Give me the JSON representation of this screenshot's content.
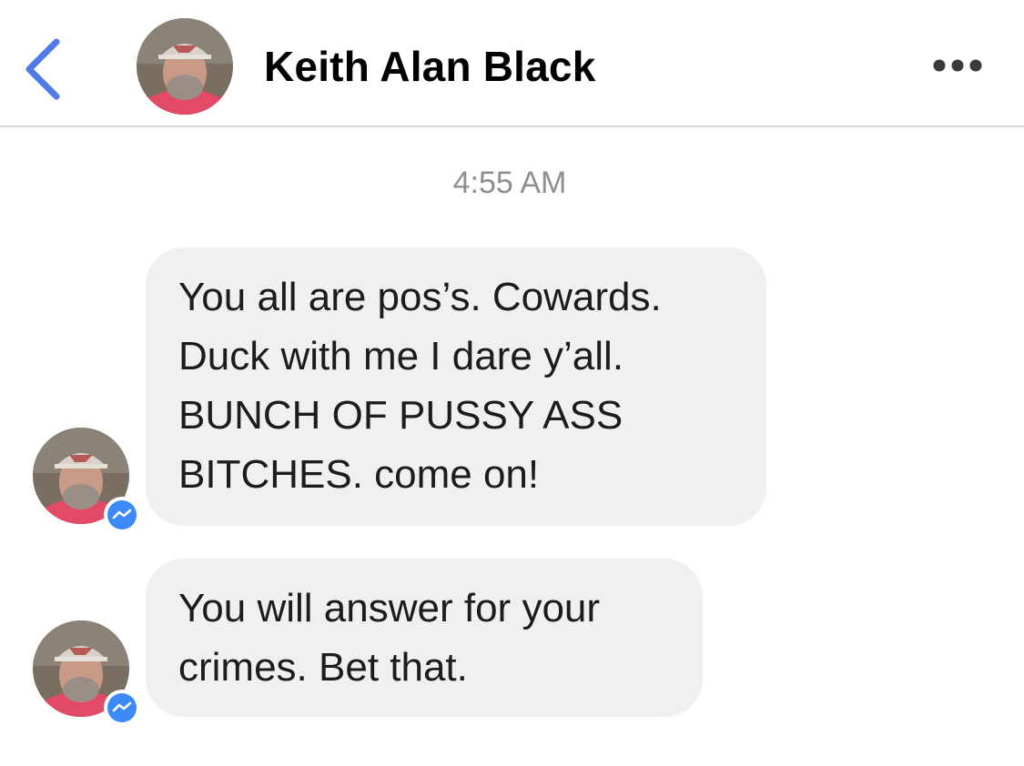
{
  "header": {
    "contact_name": "Keith Alan Black",
    "back_icon": "chevron-left-icon",
    "more_icon": "ellipsis-icon",
    "accent_color": "#4e7be8"
  },
  "conversation": {
    "timestamp": "4:55 AM",
    "messages": [
      {
        "sender": "Keith Alan Black",
        "text": "You all are pos’s. Cowards.\nDuck with me I dare y’all.\nBUNCH OF PUSSY ASS\nBITCHES. come on!"
      },
      {
        "sender": "Keith Alan Black",
        "text": "You will answer for your\ncrimes. Bet that."
      }
    ],
    "badge_icon": "messenger-icon",
    "badge_color": "#3b8af7",
    "bubble_color": "#f0f0f0"
  }
}
